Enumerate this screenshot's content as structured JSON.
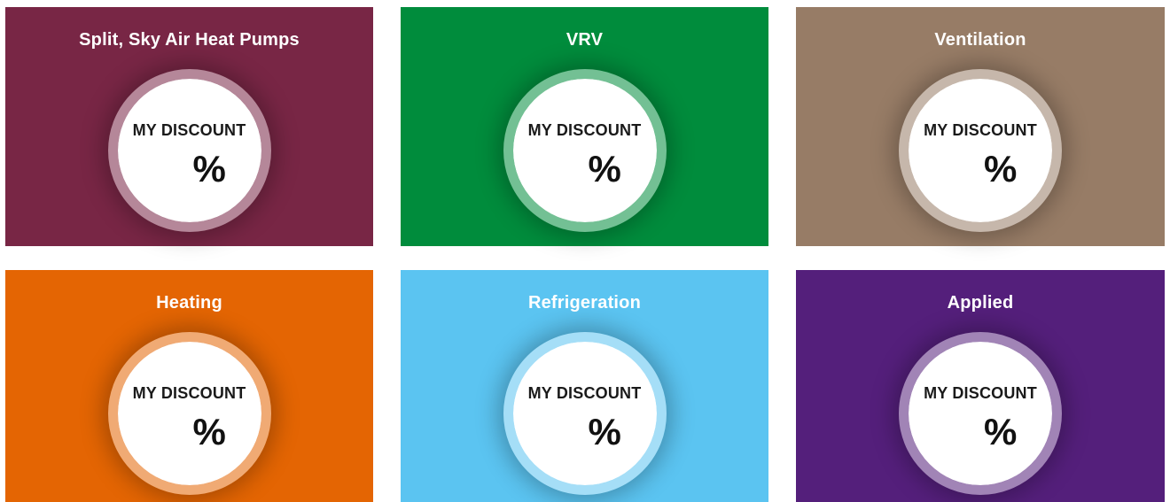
{
  "tiles": [
    {
      "title": "Split, Sky Air Heat Pumps",
      "color": "#782645",
      "discount_label": "MY DISCOUNT",
      "discount_value": "",
      "unit": "%"
    },
    {
      "title": "VRV",
      "color": "#008c3c",
      "discount_label": "MY DISCOUNT",
      "discount_value": "",
      "unit": "%"
    },
    {
      "title": "Ventilation",
      "color": "#977c66",
      "discount_label": "MY DISCOUNT",
      "discount_value": "",
      "unit": "%"
    },
    {
      "title": "Heating",
      "color": "#e46503",
      "discount_label": "MY DISCOUNT",
      "discount_value": "",
      "unit": "%"
    },
    {
      "title": "Refrigeration",
      "color": "#5bc4f1",
      "discount_label": "MY DISCOUNT",
      "discount_value": "",
      "unit": "%"
    },
    {
      "title": "Applied",
      "color": "#541f7b",
      "discount_label": "MY DISCOUNT",
      "discount_value": "",
      "unit": "%"
    }
  ]
}
